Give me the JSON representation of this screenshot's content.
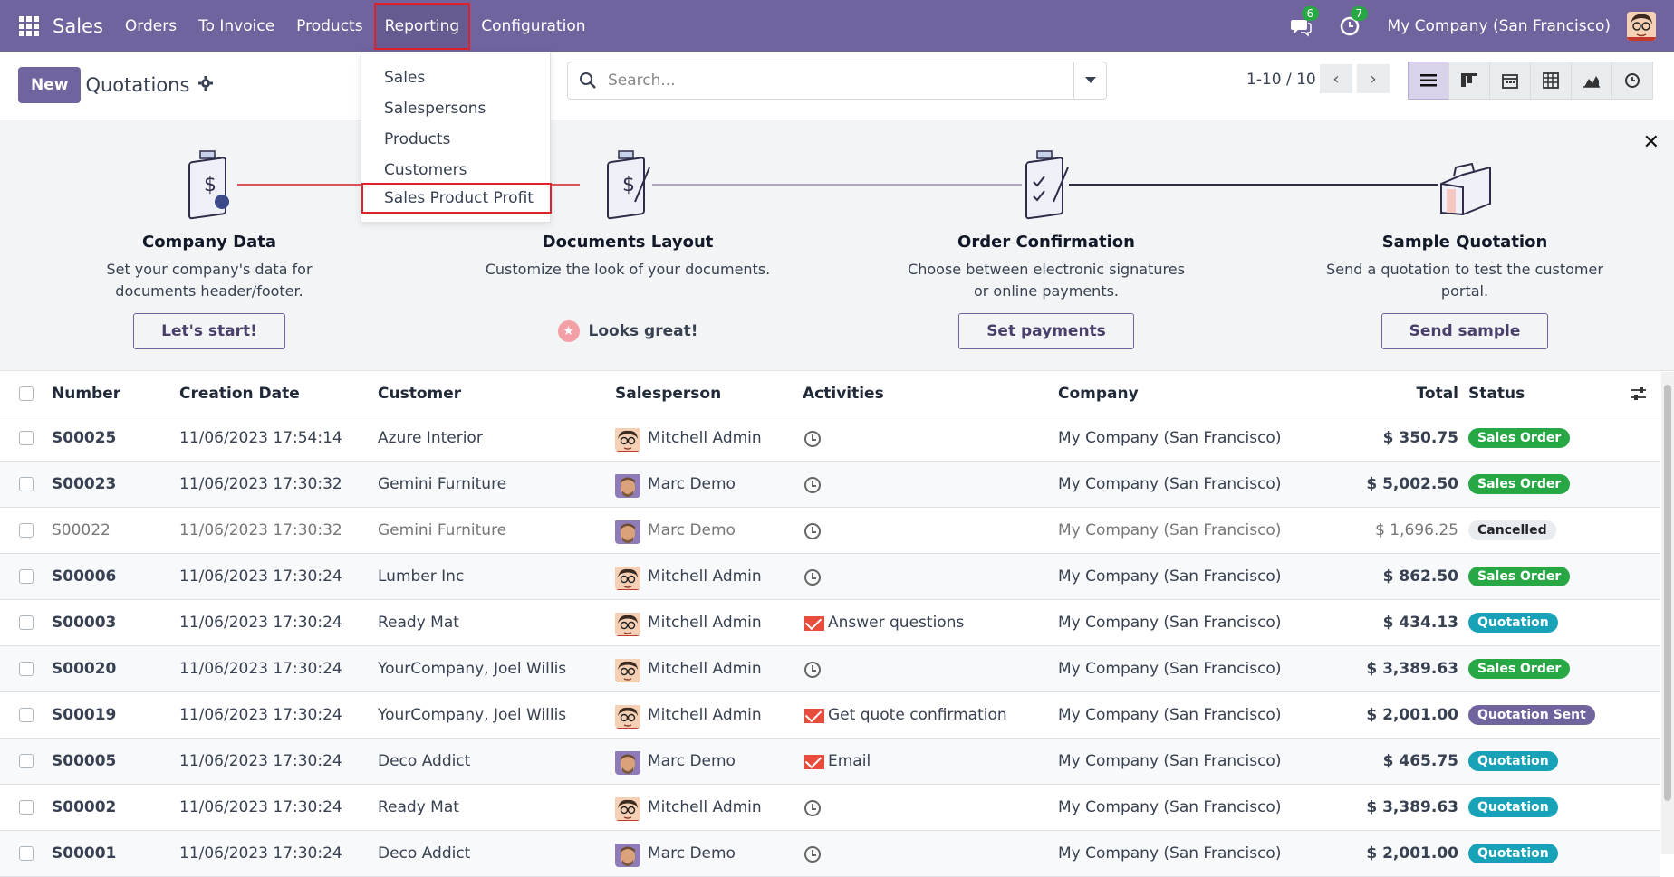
{
  "nav": {
    "app_name": "Sales",
    "menu": [
      "Orders",
      "To Invoice",
      "Products",
      "Reporting",
      "Configuration"
    ],
    "messages_count": "6",
    "activities_count": "7",
    "company": "My Company (San Francisco)"
  },
  "reporting_menu": {
    "items": [
      "Sales",
      "Salespersons",
      "Products",
      "Customers",
      "Sales Product Profit"
    ]
  },
  "control": {
    "new_label": "New",
    "title": "Quotations",
    "search_placeholder": "Search...",
    "pager": "1-10 / 10"
  },
  "onboarding": {
    "steps": [
      {
        "title": "Company Data",
        "desc": "Set your company's data for documents header/footer.",
        "button": "Let's start!"
      },
      {
        "title": "Documents Layout",
        "desc": "Customize the look of your documents.",
        "done_label": "Looks great!"
      },
      {
        "title": "Order Confirmation",
        "desc": "Choose between electronic signatures or online payments.",
        "button": "Set payments"
      },
      {
        "title": "Sample Quotation",
        "desc": "Send a quotation to test the customer portal.",
        "button": "Send sample"
      }
    ]
  },
  "table": {
    "headers": [
      "Number",
      "Creation Date",
      "Customer",
      "Salesperson",
      "Activities",
      "Company",
      "Total",
      "Status"
    ],
    "rows": [
      {
        "number": "S00025",
        "date": "11/06/2023 17:54:14",
        "customer": "Azure Interior",
        "salesperson": "Mitchell Admin",
        "activity": "",
        "company": "My Company (San Francisco)",
        "total": "$ 350.75",
        "status": "Sales Order"
      },
      {
        "number": "S00023",
        "date": "11/06/2023 17:30:32",
        "customer": "Gemini Furniture",
        "salesperson": "Marc Demo",
        "activity": "",
        "company": "My Company (San Francisco)",
        "total": "$ 5,002.50",
        "status": "Sales Order"
      },
      {
        "number": "S00022",
        "date": "11/06/2023 17:30:32",
        "customer": "Gemini Furniture",
        "salesperson": "Marc Demo",
        "activity": "",
        "company": "My Company (San Francisco)",
        "total": "$ 1,696.25",
        "status": "Cancelled"
      },
      {
        "number": "S00006",
        "date": "11/06/2023 17:30:24",
        "customer": "Lumber Inc",
        "salesperson": "Mitchell Admin",
        "activity": "",
        "company": "My Company (San Francisco)",
        "total": "$ 862.50",
        "status": "Sales Order"
      },
      {
        "number": "S00003",
        "date": "11/06/2023 17:30:24",
        "customer": "Ready Mat",
        "salesperson": "Mitchell Admin",
        "activity": "Answer questions",
        "company": "My Company (San Francisco)",
        "total": "$ 434.13",
        "status": "Quotation"
      },
      {
        "number": "S00020",
        "date": "11/06/2023 17:30:24",
        "customer": "YourCompany, Joel Willis",
        "salesperson": "Mitchell Admin",
        "activity": "",
        "company": "My Company (San Francisco)",
        "total": "$ 3,389.63",
        "status": "Sales Order"
      },
      {
        "number": "S00019",
        "date": "11/06/2023 17:30:24",
        "customer": "YourCompany, Joel Willis",
        "salesperson": "Mitchell Admin",
        "activity": "Get quote confirmation",
        "company": "My Company (San Francisco)",
        "total": "$ 2,001.00",
        "status": "Quotation Sent"
      },
      {
        "number": "S00005",
        "date": "11/06/2023 17:30:24",
        "customer": "Deco Addict",
        "salesperson": "Marc Demo",
        "activity": "Email",
        "company": "My Company (San Francisco)",
        "total": "$ 465.75",
        "status": "Quotation"
      },
      {
        "number": "S00002",
        "date": "11/06/2023 17:30:24",
        "customer": "Ready Mat",
        "salesperson": "Mitchell Admin",
        "activity": "",
        "company": "My Company (San Francisco)",
        "total": "$ 3,389.63",
        "status": "Quotation"
      },
      {
        "number": "S00001",
        "date": "11/06/2023 17:30:24",
        "customer": "Deco Addict",
        "salesperson": "Marc Demo",
        "activity": "",
        "company": "My Company (San Francisco)",
        "total": "$ 2,001.00",
        "status": "Quotation"
      }
    ]
  },
  "colors": {
    "brand": "#71639e",
    "sales_order": "#28a745",
    "quotation": "#17a2b8",
    "quotation_sent": "#71639e",
    "cancelled": "#e9ecef",
    "highlight": "#e0202a"
  }
}
